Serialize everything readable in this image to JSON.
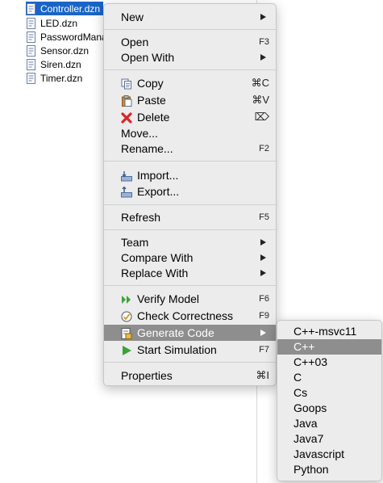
{
  "files": [
    {
      "name": "Controller.dzn",
      "selected": true
    },
    {
      "name": "LED.dzn",
      "selected": false
    },
    {
      "name": "PasswordMana",
      "selected": false
    },
    {
      "name": "Sensor.dzn",
      "selected": false
    },
    {
      "name": "Siren.dzn",
      "selected": false
    },
    {
      "name": "Timer.dzn",
      "selected": false
    }
  ],
  "menu": {
    "new": {
      "label": "New"
    },
    "open": {
      "label": "Open",
      "shortcut": "F3"
    },
    "open_with": {
      "label": "Open With"
    },
    "copy": {
      "label": "Copy",
      "shortcut": "⌘C",
      "icon": "copy-icon"
    },
    "paste": {
      "label": "Paste",
      "shortcut": "⌘V",
      "icon": "paste-icon"
    },
    "delete": {
      "label": "Delete",
      "shortcut": "⌦",
      "icon": "delete-icon"
    },
    "move": {
      "label": "Move..."
    },
    "rename": {
      "label": "Rename...",
      "shortcut": "F2"
    },
    "import": {
      "label": "Import...",
      "icon": "import-icon"
    },
    "export": {
      "label": "Export...",
      "icon": "export-icon"
    },
    "refresh": {
      "label": "Refresh",
      "shortcut": "F5"
    },
    "team": {
      "label": "Team"
    },
    "compare_with": {
      "label": "Compare With"
    },
    "replace_with": {
      "label": "Replace With"
    },
    "verify_model": {
      "label": "Verify Model",
      "shortcut": "F6",
      "icon": "verify-icon"
    },
    "check_correctness": {
      "label": "Check Correctness",
      "shortcut": "F9",
      "icon": "check-icon"
    },
    "generate_code": {
      "label": "Generate Code",
      "icon": "generate-icon",
      "highlighted": true
    },
    "start_simulation": {
      "label": "Start Simulation",
      "shortcut": "F7",
      "icon": "play-icon"
    },
    "properties": {
      "label": "Properties",
      "shortcut": "⌘I"
    }
  },
  "submenu": {
    "items": [
      "C++-msvc11",
      "C++",
      "C++03",
      "C",
      "Cs",
      "Goops",
      "Java",
      "Java7",
      "Javascript",
      "Python"
    ],
    "highlighted": "C++"
  },
  "colors": {
    "selection": "#1a64c8",
    "menu_bg": "#ececec",
    "menu_highlight": "#8e8e8e"
  }
}
